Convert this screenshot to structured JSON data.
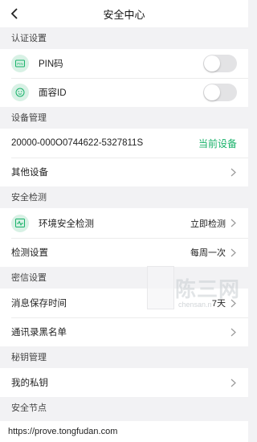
{
  "header": {
    "title": "安全中心"
  },
  "sections": {
    "auth": {
      "title": "认证设置",
      "pin": {
        "label": "PIN码",
        "enabled": false
      },
      "face": {
        "label": "面容ID",
        "enabled": false
      }
    },
    "device": {
      "title": "设备管理",
      "current_id": "20000-000O0744622-5327811S",
      "current_tag": "当前设备",
      "other": "其他设备"
    },
    "check": {
      "title": "安全检测",
      "env": {
        "label": "环境安全检测",
        "action": "立即检测"
      },
      "settings": {
        "label": "检测设置",
        "value": "每周一次"
      }
    },
    "msg": {
      "title": "密信设置",
      "retention": {
        "label": "消息保存时间",
        "value": "7天"
      },
      "blacklist": "通讯录黑名单"
    },
    "key": {
      "title": "秘钥管理",
      "private": "我的私钥"
    },
    "node": {
      "title": "安全节点"
    }
  },
  "watermark": {
    "big": "陈三网",
    "small": "chensan.n"
  },
  "status_url": "https://prove.tongfudan.com",
  "colors": {
    "accent": "#18b26a",
    "icon_bg": "#d8f1e5",
    "page_bg": "#f2f2f4"
  }
}
